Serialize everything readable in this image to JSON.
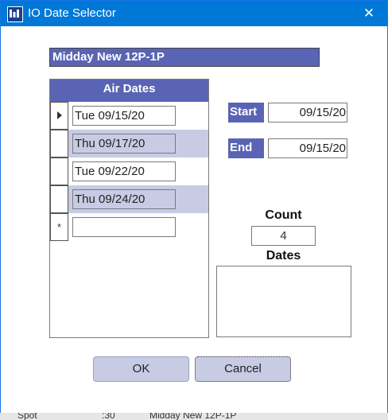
{
  "window": {
    "title": "IO Date Selector",
    "close_glyph": "✕"
  },
  "program": {
    "name": "Midday New 12P-1P"
  },
  "grid": {
    "header": "Air Dates",
    "rows": [
      {
        "selector": "current",
        "date": "Tue 09/15/20"
      },
      {
        "selector": "",
        "date": "Thu 09/17/20"
      },
      {
        "selector": "",
        "date": "Tue 09/22/20"
      },
      {
        "selector": "",
        "date": "Thu 09/24/20"
      },
      {
        "selector": "*",
        "date": ""
      }
    ]
  },
  "range": {
    "start_label": "Start",
    "start_value": "09/15/20",
    "end_label": "End",
    "end_value": "09/15/20"
  },
  "count": {
    "label": "Count",
    "value": "4"
  },
  "dates": {
    "label": "Dates"
  },
  "buttons": {
    "ok": "OK",
    "cancel": "Cancel"
  },
  "background_strip": {
    "col1": "Spot",
    "col2": ":30",
    "col3": "Midday New 12P-1P"
  },
  "colors": {
    "accent": "#5a64b4",
    "titlebar": "#0078d7",
    "row_alt": "#c8cbe4"
  }
}
